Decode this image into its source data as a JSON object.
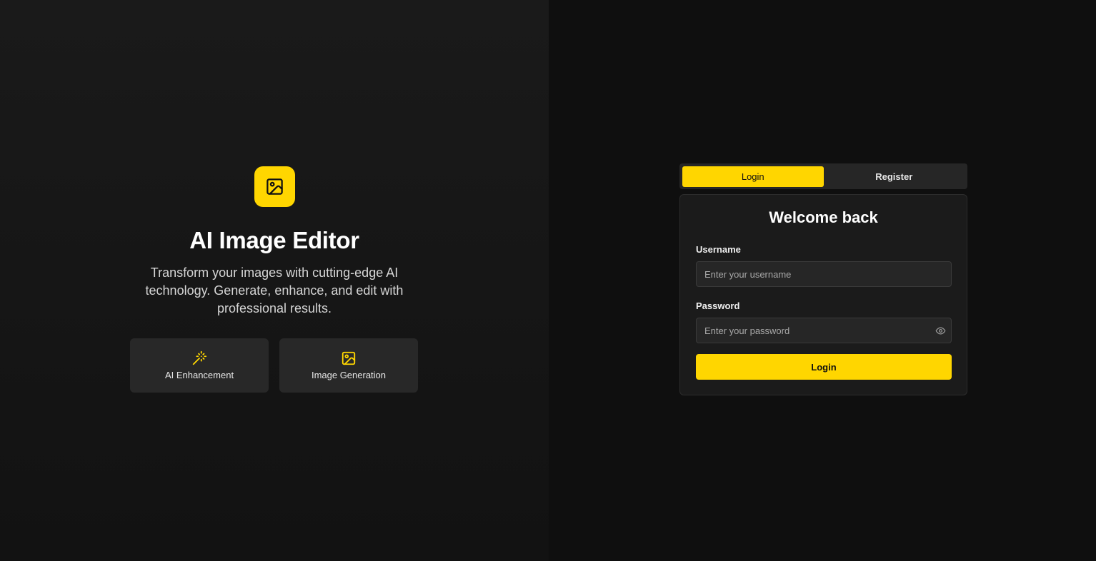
{
  "hero": {
    "logo_icon": "image-icon",
    "title": "AI Image Editor",
    "subtitle": "Transform your images with cutting-edge AI technology. Generate, enhance, and edit with professional results.",
    "features": [
      {
        "label": "AI Enhancement",
        "icon": "magic-wand-icon"
      },
      {
        "label": "Image Generation",
        "icon": "image-icon"
      }
    ]
  },
  "auth": {
    "tabs": [
      {
        "label": "Login",
        "active": true
      },
      {
        "label": "Register",
        "active": false
      }
    ],
    "card": {
      "title": "Welcome back",
      "username_label": "Username",
      "username_placeholder": "Enter your username",
      "username_value": "",
      "password_label": "Password",
      "password_placeholder": "Enter your password",
      "password_value": "",
      "password_toggle_icon": "eye-icon",
      "submit_label": "Login"
    }
  },
  "colors": {
    "accent": "#ffd600",
    "background": "#0f0f0f",
    "card": "#1b1b1b",
    "input": "#262626"
  }
}
